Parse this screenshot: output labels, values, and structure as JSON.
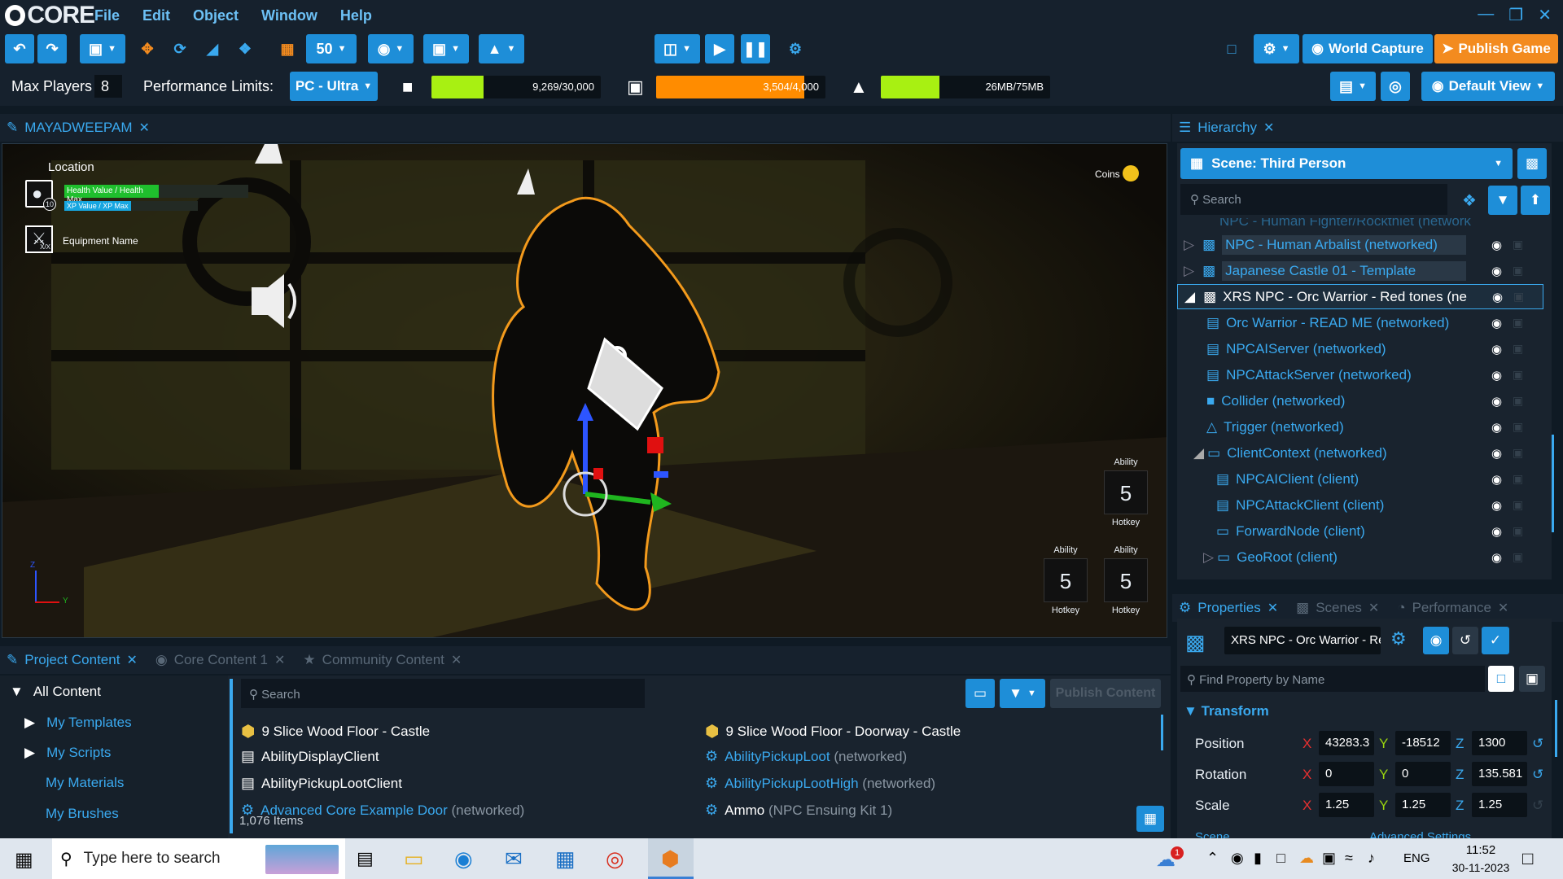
{
  "app": {
    "name": "CORE"
  },
  "menu": [
    "File",
    "Edit",
    "Object",
    "Window",
    "Help"
  ],
  "toolbar": {
    "grid_size": "50",
    "world_capture": "World Capture",
    "publish_game": "Publish Game"
  },
  "perf": {
    "max_players_label": "Max Players",
    "max_players_value": "8",
    "limits_label": "Performance Limits:",
    "limits_value": "PC - Ultra",
    "objects_text": "9,269/30,000",
    "objects_fraction": 0.309,
    "networked_text": "3,504/4,000",
    "networked_fraction": 0.876,
    "memory_text": "26MB/75MB",
    "memory_fraction": 0.347,
    "default_view": "Default View"
  },
  "colors": {
    "accent": "#1e8ed8",
    "publish": "#f38b1f",
    "bar_green": "#a8f012",
    "bar_orange": "#ff8c00",
    "link": "#3aa9ef"
  },
  "viewport": {
    "tab": "MAYADWEEPAM",
    "hud": {
      "location": "Location",
      "health": "Health Value / Health Max",
      "xp": "XP Value / XP Max",
      "level": "10",
      "equip_ratio": "X/X",
      "equipment": "Equipment Name",
      "coins": "Coins",
      "abilities": [
        {
          "label": "Ability",
          "key": "5",
          "hotkey": "Hotkey"
        },
        {
          "label": "Ability",
          "key": "5",
          "hotkey": "Hotkey"
        },
        {
          "label": "Ability",
          "key": "5",
          "hotkey": "Hotkey"
        }
      ],
      "axis_z": "Z",
      "axis_y": "Y"
    }
  },
  "hierarchy": {
    "title": "Hierarchy",
    "scene": "Scene: Third Person",
    "search_placeholder": "Search",
    "cut_row": "NPC - Human Fighter/Rockthiet (network",
    "items": [
      {
        "label": "NPC - Human Arbalist (networked)",
        "type": "template"
      },
      {
        "label": "Japanese Castle 01 - Template",
        "type": "template"
      },
      {
        "label": "XRS NPC - Orc Warrior - Red tones (netw",
        "type": "selected"
      },
      {
        "label": "Orc Warrior - READ ME (networked)",
        "type": "script"
      },
      {
        "label": "NPCAIServer (networked)",
        "type": "script"
      },
      {
        "label": "NPCAttackServer (networked)",
        "type": "script"
      },
      {
        "label": "Collider (networked)",
        "type": "cube"
      },
      {
        "label": "Trigger (networked)",
        "type": "trigger"
      },
      {
        "label": "ClientContext (networked)",
        "type": "folder"
      },
      {
        "label": "NPCAIClient (client)",
        "type": "script"
      },
      {
        "label": "NPCAttackClient (client)",
        "type": "script"
      },
      {
        "label": "ForwardNode (client)",
        "type": "folder"
      },
      {
        "label": "GeoRoot (client)",
        "type": "folder"
      }
    ]
  },
  "properties": {
    "tabs": [
      "Properties",
      "Scenes",
      "Performance"
    ],
    "name": "XRS NPC - Orc Warrior - Red to",
    "find_placeholder": "Find Property by Name",
    "section": "Transform",
    "rows": [
      {
        "label": "Position",
        "x": "43283.3",
        "y": "-18512",
        "z": "1300"
      },
      {
        "label": "Rotation",
        "x": "0",
        "y": "0",
        "z": "135.581"
      },
      {
        "label": "Scale",
        "x": "1.25",
        "y": "1.25",
        "z": "1.25"
      }
    ],
    "cut_left": "Scene",
    "cut_right": "Advanced Settings"
  },
  "content": {
    "tabs": [
      "Project Content",
      "Core Content",
      "Community Content"
    ],
    "core_badge": "1",
    "tree": [
      "All Content",
      "My Templates",
      "My Scripts",
      "My Materials",
      "My Brushes"
    ],
    "search_placeholder": "Search",
    "publish_label": "Publish Content",
    "items_left": [
      {
        "name": "9 Slice Wood Floor - Castle",
        "suffix": ""
      },
      {
        "name": "AbilityDisplayClient",
        "suffix": ""
      },
      {
        "name": "AbilityPickupLootClient",
        "suffix": ""
      },
      {
        "name": "Advanced Core Example Door",
        "suffix": "(networked)"
      }
    ],
    "items_right": [
      {
        "name": "9 Slice Wood Floor - Doorway - Castle",
        "suffix": ""
      },
      {
        "name": "AbilityPickupLoot",
        "suffix": "(networked)"
      },
      {
        "name": "AbilityPickupLootHigh",
        "suffix": "(networked)"
      },
      {
        "name": "Ammo",
        "suffix": "(NPC Ensuing Kit 1)"
      }
    ],
    "count": "1,076 Items"
  },
  "taskbar": {
    "search": "Type here to search",
    "lang": "ENG",
    "time": "11:52",
    "date": "30-11-2023",
    "notif": "1"
  }
}
